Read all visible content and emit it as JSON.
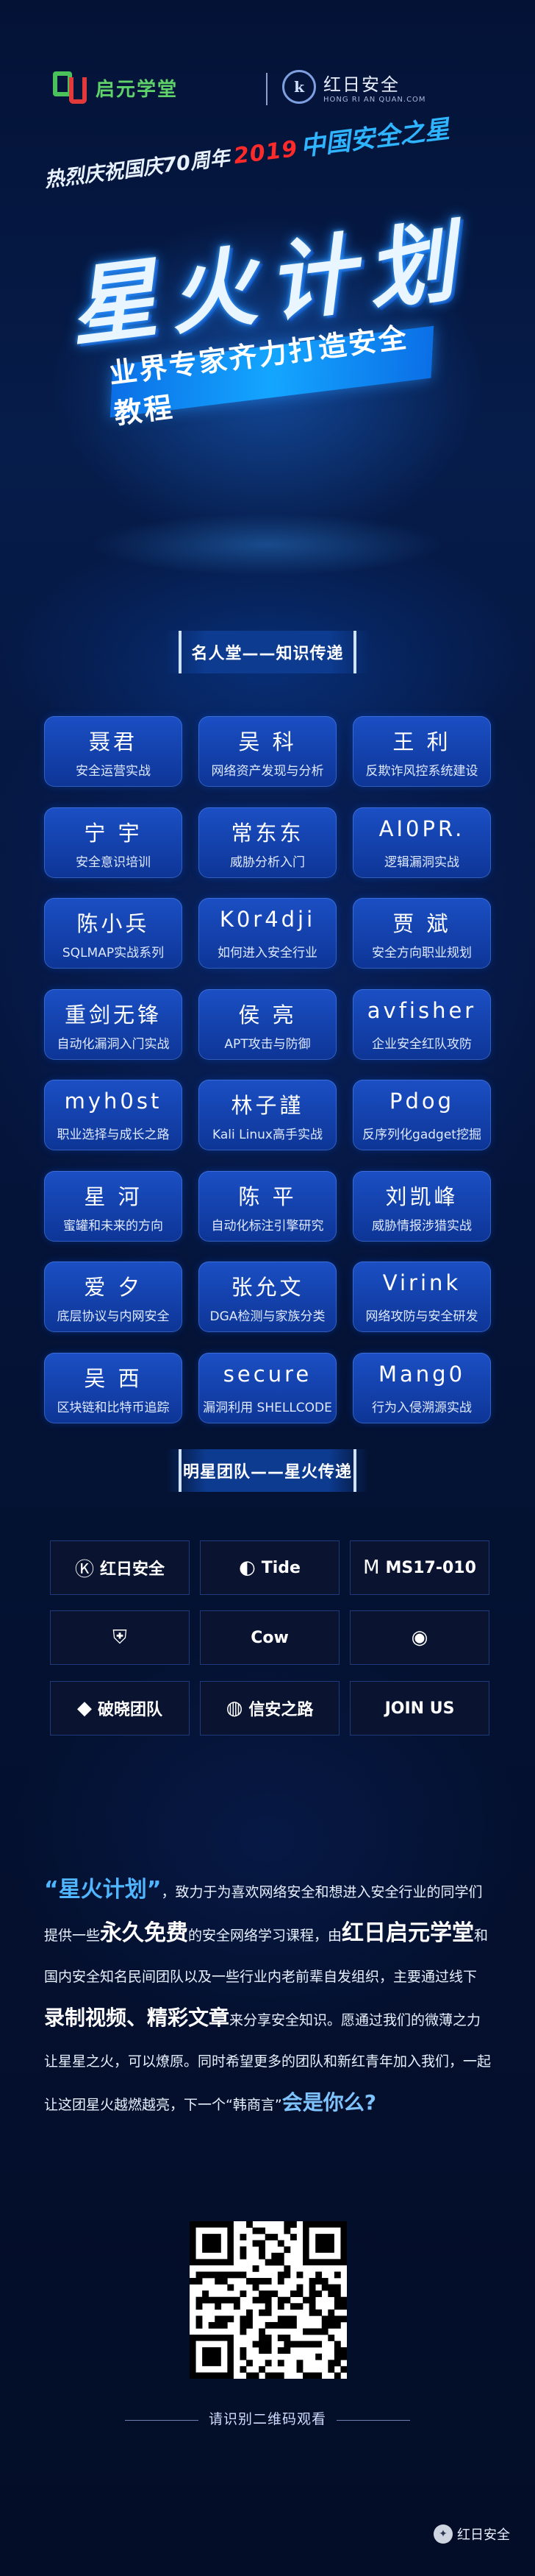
{
  "header": {
    "left_logo": {
      "name": "启元学堂",
      "tagline": ""
    },
    "right_logo": {
      "mark": "k",
      "name": "红日安全",
      "url": "HONG RI AN QUAN.COM"
    }
  },
  "banner": {
    "line1": "热烈庆祝国庆70周年",
    "year": "2019",
    "line1b": "中国安全之星",
    "title": "星火计划",
    "subtitle": "业界专家齐力打造安全教程"
  },
  "experts_section": {
    "title": "名人堂——知识传递",
    "experts": [
      {
        "name": "聂君",
        "topic": "安全运营实战"
      },
      {
        "name": "吴 科",
        "topic": "网络资产发现与分析"
      },
      {
        "name": "王 利",
        "topic": "反欺诈风控系统建设"
      },
      {
        "name": "宁 宇",
        "topic": "安全意识培训"
      },
      {
        "name": "常东东",
        "topic": "威胁分析入门"
      },
      {
        "name": "AI0PR.",
        "topic": "逻辑漏洞实战"
      },
      {
        "name": "陈小兵",
        "topic": "SQLMAP实战系列"
      },
      {
        "name": "K0r4dji",
        "topic": "如何进入安全行业"
      },
      {
        "name": "贾 斌",
        "topic": "安全方向职业规划"
      },
      {
        "name": "重剑无锋",
        "topic": "自动化漏洞入门实战"
      },
      {
        "name": "侯 亮",
        "topic": "APT攻击与防御"
      },
      {
        "name": "avfisher",
        "topic": "企业安全红队攻防"
      },
      {
        "name": "myh0st",
        "topic": "职业选择与成长之路"
      },
      {
        "name": "林子謹",
        "topic": "Kali Linux高手实战"
      },
      {
        "name": "Pdog",
        "topic": "反序列化gadget挖掘"
      },
      {
        "name": "星 河",
        "topic": "蜜罐和未来的方向"
      },
      {
        "name": "陈 平",
        "topic": "自动化标注引擎研究"
      },
      {
        "name": "刘凯峰",
        "topic": "威胁情报涉猎实战"
      },
      {
        "name": "爱 夕",
        "topic": "底层协议与内网安全"
      },
      {
        "name": "张允文",
        "topic": "DGA检测与家族分类"
      },
      {
        "name": "Virink",
        "topic": "网络攻防与安全研发"
      },
      {
        "name": "吴 西",
        "topic": "区块链和比特币追踪"
      },
      {
        "name": "secure",
        "topic": "漏洞利用 SHELLCODE"
      },
      {
        "name": "Mang0",
        "topic": "行为入侵溯源实战"
      }
    ]
  },
  "teams_section": {
    "title": "明星团队——星火传递",
    "teams": [
      {
        "icon": "hongri-logo",
        "glyph": "Ⓚ",
        "label": "红日安全"
      },
      {
        "icon": "tide-logo",
        "glyph": "◐",
        "label": "Tide"
      },
      {
        "icon": "ms17-logo",
        "glyph": "M",
        "label": "MS17-010"
      },
      {
        "icon": "shield-logo",
        "glyph": "⛨",
        "label": ""
      },
      {
        "icon": "cowz-logo",
        "glyph": "",
        "label": "Cow"
      },
      {
        "icon": "seal-logo",
        "glyph": "◉",
        "label": ""
      },
      {
        "icon": "pxiao-logo",
        "glyph": "◆",
        "label": "破晓团队"
      },
      {
        "icon": "xinan-logo",
        "glyph": "◍",
        "label": "信安之路"
      },
      {
        "icon": "join-logo",
        "glyph": "",
        "label": "JOIN US"
      }
    ]
  },
  "intro": {
    "p1_quote": "“星火计划”",
    "p1a": "，致力于为喜欢网络安全和想进入安全行业的同学们提供一些",
    "p1_hl": "永久免费",
    "p1b": "的安全网络学习课程，由",
    "p2_hl": "红日启元学堂",
    "p2a": "和国内安全知名民间团队以及一些行业内老前辈自发组织，主要通过线下",
    "p2_hl2": "录制视频、精彩文章",
    "p2b": "来分享安全知识。愿通过我们的微薄之力让星星之火，可以燎原。同时希望更多的团队和新红青年加入我们，一起让这团星火越燃越亮，下一个“韩商言”",
    "cta": "会是你么?"
  },
  "qr": {
    "caption": "请识别二维码观看"
  },
  "watermark": {
    "label": "红日安全"
  }
}
